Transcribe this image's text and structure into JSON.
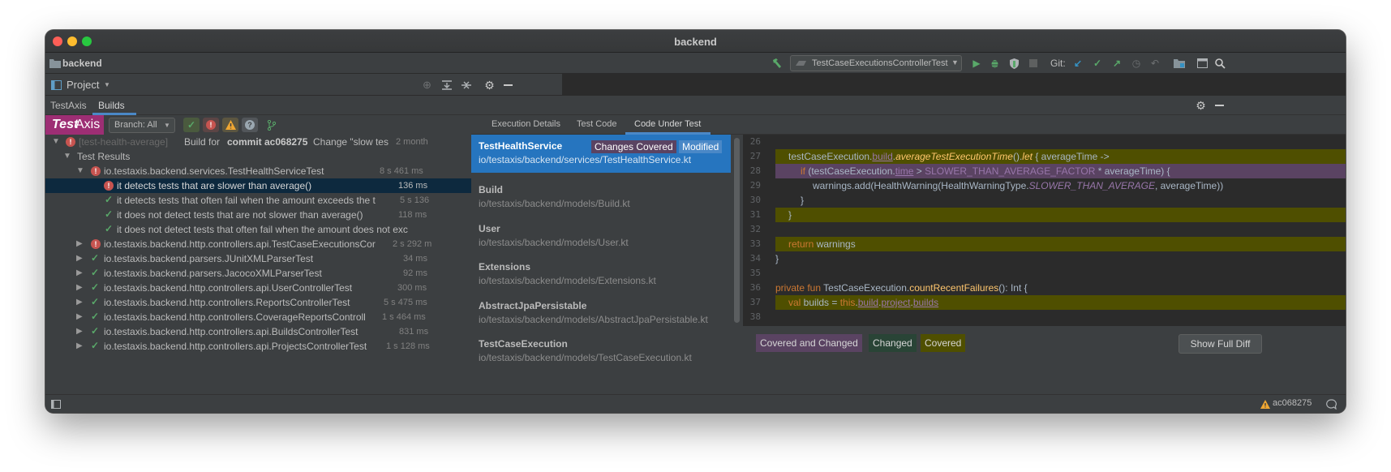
{
  "window": {
    "title": "backend"
  },
  "navbar": {
    "project": "backend",
    "run_config": "TestCaseExecutionsControllerTest",
    "git_label": "Git:"
  },
  "projbar": {
    "label": "Project"
  },
  "tool_tabs": [
    "TestAxis",
    "Builds"
  ],
  "builds_toolbar": {
    "logo_part1": "Test",
    "logo_part2": "Axis",
    "branch": "Branch: All"
  },
  "tree": {
    "build_row": {
      "branch": "[test-health-average]",
      "text_pre": "Build for",
      "commit": "commit ac068275",
      "message": "Change \"slow tes",
      "time": "2 month"
    },
    "results_label": "Test Results",
    "suite": {
      "name": "io.testaxis.backend.services.TestHealthServiceTest",
      "time": "8 s 461 ms"
    },
    "tests": [
      {
        "name": "it detects tests that are slower than average()",
        "time": "136 ms",
        "status": "fail",
        "selected": true
      },
      {
        "name": "it detects tests that often fail when the amount exceeds the t",
        "time": "5 s 136",
        "status": "pass",
        "selected": false
      },
      {
        "name": "it does not detect tests that are not slower than average()",
        "time": "118 ms",
        "status": "pass",
        "selected": false
      },
      {
        "name": "it does not detect tests that often fail when the amount does not exc",
        "time": "",
        "status": "pass",
        "selected": false
      }
    ],
    "suites": [
      {
        "name": "io.testaxis.backend.http.controllers.api.TestCaseExecutionsCor",
        "time": "2 s 292 m",
        "status": "fail"
      },
      {
        "name": "io.testaxis.backend.parsers.JUnitXMLParserTest",
        "time": "34 ms",
        "status": "pass"
      },
      {
        "name": "io.testaxis.backend.parsers.JacocoXMLParserTest",
        "time": "92 ms",
        "status": "pass"
      },
      {
        "name": "io.testaxis.backend.http.controllers.api.UserControllerTest",
        "time": "300 ms",
        "status": "pass"
      },
      {
        "name": "io.testaxis.backend.http.controllers.ReportsControllerTest",
        "time": "5 s 475 ms",
        "status": "pass"
      },
      {
        "name": "io.testaxis.backend.http.controllers.CoverageReportsControll",
        "time": "1 s 464 ms",
        "status": "pass"
      },
      {
        "name": "io.testaxis.backend.http.controllers.api.BuildsControllerTest",
        "time": "831 ms",
        "status": "pass"
      },
      {
        "name": "io.testaxis.backend.http.controllers.api.ProjectsControllerTest",
        "time": "1 s 128 ms",
        "status": "pass"
      }
    ]
  },
  "detail_tabs": [
    "Execution Details",
    "Test Code",
    "Code Under Test"
  ],
  "classes": [
    {
      "name": "TestHealthService",
      "path": "io/testaxis/backend/services/TestHealthService.kt",
      "badge1": "Changes Covered",
      "badge2": "Modified",
      "active": true
    },
    {
      "name": "Build",
      "path": "io/testaxis/backend/models/Build.kt",
      "active": false
    },
    {
      "name": "User",
      "path": "io/testaxis/backend/models/User.kt",
      "active": false
    },
    {
      "name": "Extensions",
      "path": "io/testaxis/backend/models/Extensions.kt",
      "active": false
    },
    {
      "name": "AbstractJpaPersistable",
      "path": "io/testaxis/backend/models/AbstractJpaPersistable.kt",
      "active": false
    },
    {
      "name": "TestCaseExecution",
      "path": "io/testaxis/backend/models/TestCaseExecution.kt",
      "active": false
    }
  ],
  "editor": {
    "line_numbers": [
      "26",
      "27",
      "28",
      "29",
      "30",
      "31",
      "32",
      "33",
      "34",
      "35",
      "36",
      "37",
      "38"
    ],
    "l27": {
      "a": "testCaseExecution.",
      "b": "build",
      "c": ".",
      "d": "averageTestExecutionTime",
      "e": "().",
      "f": "let",
      "g": " { averageTime ->"
    },
    "l28": {
      "a": "if",
      "b": " (testCaseExecution.",
      "c": "time",
      "d": " > ",
      "e": "SLOWER_THAN_AVERAGE_FACTOR",
      "f": " * averageTime) {"
    },
    "l29": {
      "a": "warnings.add(HealthWarning(HealthWarningType.",
      "b": "SLOWER_THAN_AVERAGE",
      "c": ", averageTime))"
    },
    "l30": "}",
    "l31": "}",
    "l33": {
      "a": "return",
      "b": " warnings"
    },
    "l34": "}",
    "l36": {
      "a": "private fun",
      "b": " TestCaseExecution.",
      "c": "countRecentFailures",
      "d": "(): Int {"
    },
    "l37": {
      "a": "val",
      "b": " builds = ",
      "c": "this",
      "d": ".",
      "e": "build",
      "f": ".",
      "g": "project",
      "h": ".",
      "i": "builds"
    }
  },
  "legend": {
    "covered_changed": "Covered and Changed",
    "changed": "Changed",
    "covered": "Covered",
    "show_full_diff": "Show Full Diff"
  },
  "statusbar": {
    "commit": "ac068275"
  },
  "colors": {
    "selection_blue": "#2675bf",
    "covered_olive": "#4f4f00",
    "covered_changed_purple": "#5a4362",
    "changed_green": "#294436",
    "pass_green": "#59a869",
    "fail_red": "#c75450"
  }
}
